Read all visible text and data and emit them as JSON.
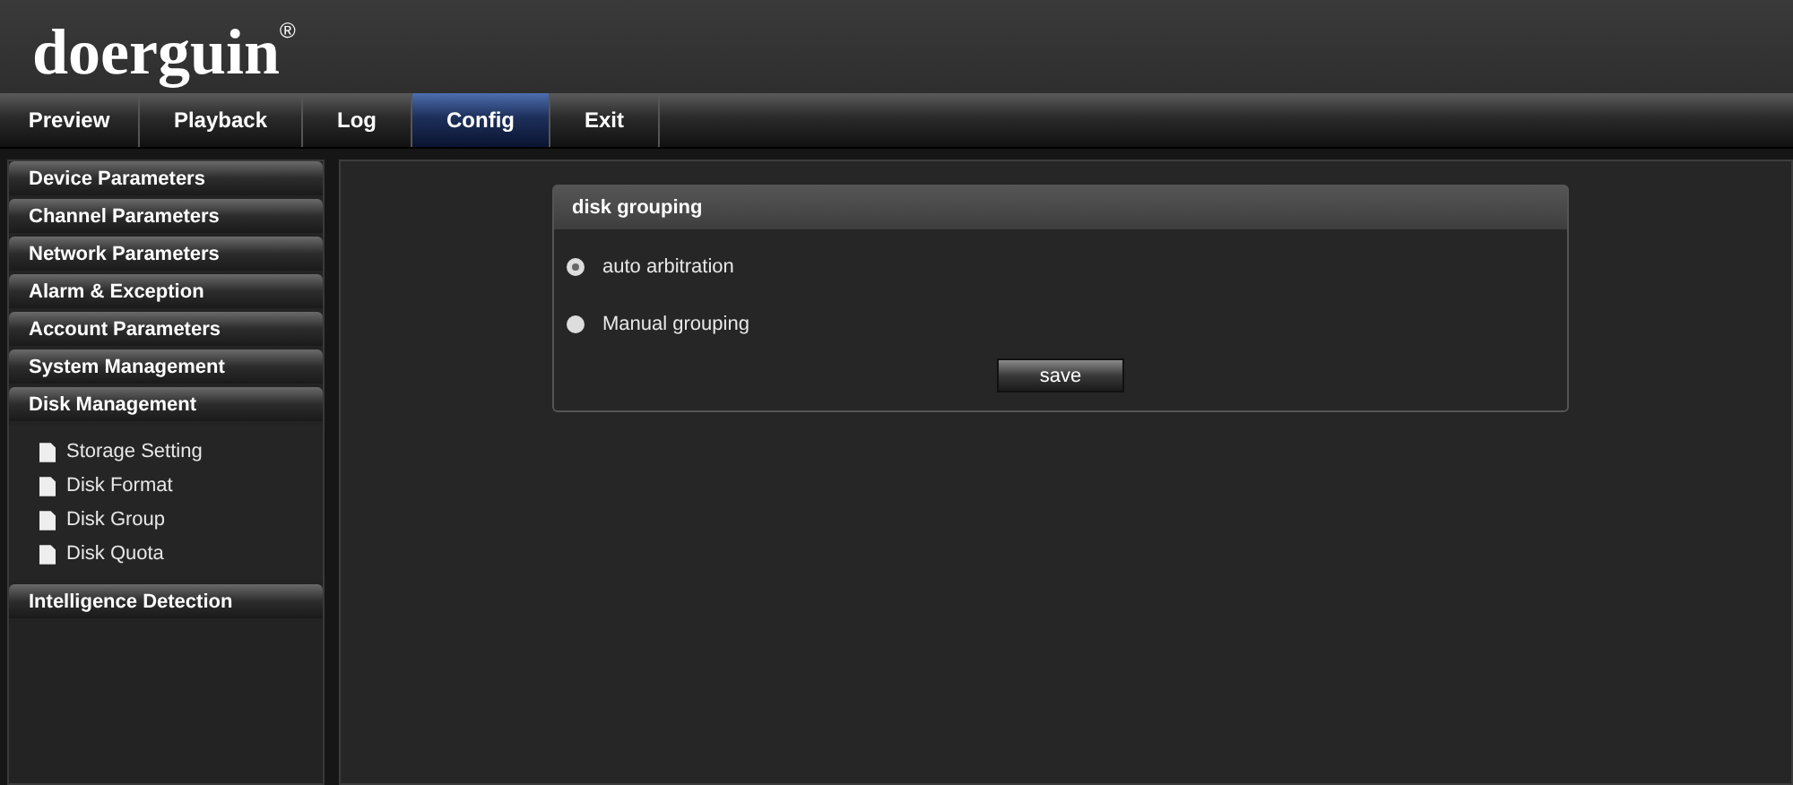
{
  "logo": "doerguin$^{®}$",
  "tabs": [
    {
      "label": "Preview",
      "selected": false
    },
    {
      "label": "Playback",
      "selected": false
    },
    {
      "label": "Log",
      "selected": false
    },
    {
      "label": "Config",
      "selected": true
    },
    {
      "label": "Exit",
      "selected": false
    }
  ],
  "sidebar": {
    "items": [
      {
        "label": "Device Parameters"
      },
      {
        "label": "Channel Parameters"
      },
      {
        "label": "Network Parameters"
      },
      {
        "label": "Alarm & Exception"
      },
      {
        "label": "Account Parameters"
      },
      {
        "label": "System Management"
      },
      {
        "label": "Disk Management",
        "children": [
          {
            "label": "Storage Setting"
          },
          {
            "label": "Disk Format"
          },
          {
            "label": "Disk Group"
          },
          {
            "label": "Disk Quota"
          }
        ]
      },
      {
        "label": "Intelligence Detection"
      }
    ]
  },
  "panel": {
    "title": "disk grouping",
    "options": [
      {
        "label": "auto arbitration",
        "selected": true
      },
      {
        "label": "Manual grouping",
        "selected": false
      }
    ],
    "button": "save"
  }
}
